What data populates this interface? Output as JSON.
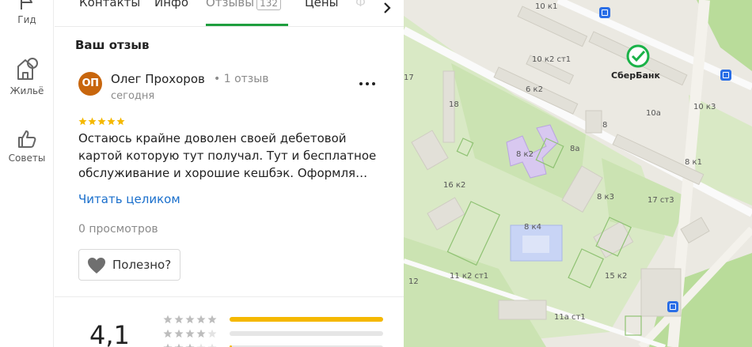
{
  "rail": {
    "items": [
      {
        "label": "Гид",
        "icon": "flag-icon"
      },
      {
        "label": "Жильё",
        "icon": "house-tree-icon"
      },
      {
        "label": "Советы",
        "icon": "thumbs-up-icon"
      }
    ]
  },
  "tabs": {
    "items": [
      {
        "label": "Контакты"
      },
      {
        "label": "Инфо"
      },
      {
        "label": "Отзывы",
        "count": "132",
        "active": true
      },
      {
        "label": "Цены"
      }
    ],
    "faded_label": "Ф",
    "accent_color": "#1e9e3e"
  },
  "review": {
    "section_title": "Ваш отзыв",
    "avatar_initials": "ОП",
    "avatar_color": "#c8660d",
    "author": "Олег Прохоров",
    "author_meta": "• 1 отзыв",
    "date": "сегодня",
    "rating": 5,
    "text": "Остаюсь крайне доволен своей дебетовой картой которую тут получал. Тут и бесплатное обслуживание и хорошие кешбэк. Оформля…",
    "read_more": "Читать целиком",
    "views": "0 просмотров",
    "useful_label": "Полезно?"
  },
  "summary": {
    "rating_value": "4,1",
    "distribution": [
      {
        "stars": 5,
        "share": 1.0
      },
      {
        "stars": 4,
        "share": 0.0
      },
      {
        "stars": 3,
        "share": 0.01
      }
    ]
  },
  "map": {
    "poi_name": "СберБанк",
    "labels": [
      "10 к1",
      "10 к2 ст1",
      "10 к3",
      "10а",
      "6 к2",
      "18",
      "17",
      "8",
      "8а",
      "8 к2",
      "8 к1",
      "16 к2",
      "8 к3",
      "17 ст3",
      "8 к4",
      "11 к2 ст1",
      "15 к2",
      "12",
      "11а ст1"
    ]
  }
}
